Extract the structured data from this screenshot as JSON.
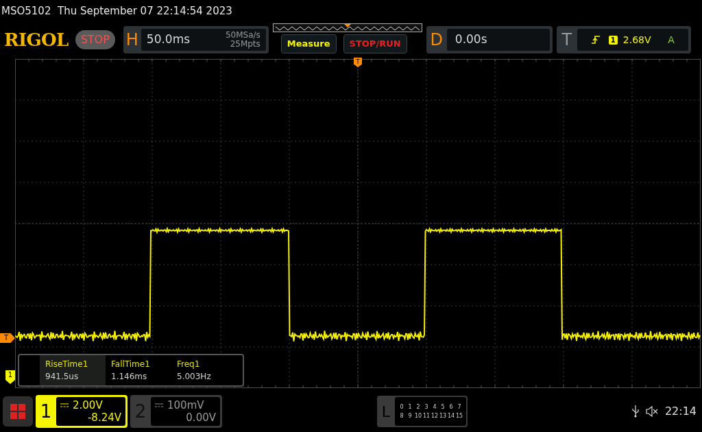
{
  "status_line": "MSO5102  Thu September 07 22:14:54 2023",
  "header": {
    "logo": "RIGOL",
    "run_state": "STOP",
    "horizontal": {
      "label": "H",
      "timebase": "50.0ms",
      "sample_rate": "50MSa/s",
      "memory_depth": "25Mpts"
    },
    "buttons": [
      {
        "label": "Measure",
        "kind": "measure"
      },
      {
        "label": "STOP/RUN",
        "kind": "run"
      }
    ],
    "delay": {
      "label": "D",
      "value": "0.00s"
    },
    "trigger": {
      "label": "T",
      "source": "1",
      "level": "2.68V",
      "mode": "A"
    }
  },
  "screen": {
    "trigger_position_marker": "T",
    "trigger_level_marker": "T",
    "channel_marker": "1"
  },
  "measurements": [
    {
      "name": "RiseTime1",
      "value": "941.5us",
      "selected": true
    },
    {
      "name": "FallTime1",
      "value": "1.146ms",
      "selected": false
    },
    {
      "name": "Freq1",
      "value": "5.003Hz",
      "selected": false
    }
  ],
  "channels": [
    {
      "number": "1",
      "scale": "2.00V",
      "offset": "-8.24V",
      "selected": true
    },
    {
      "number": "2",
      "scale": "100mV",
      "offset": "0.00V",
      "selected": false
    }
  ],
  "logic": {
    "label": "L",
    "rows": [
      [
        "0",
        "1",
        "2",
        "3",
        "4",
        "5",
        "6",
        "7"
      ],
      [
        "8",
        "9",
        "10",
        "11",
        "12",
        "13",
        "14",
        "15"
      ]
    ]
  },
  "clock": "22:14"
}
